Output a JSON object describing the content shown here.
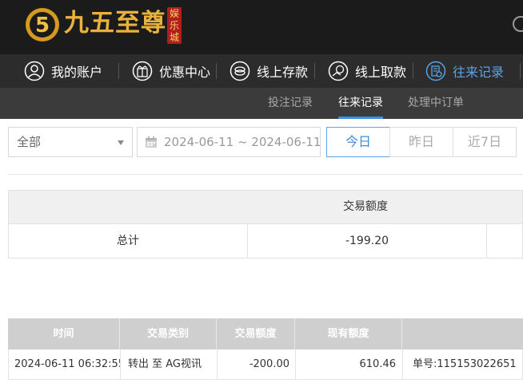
{
  "brand": {
    "name": "九五至尊",
    "badge": "娱乐城",
    "logo_icon": "five-coin-logo"
  },
  "nav": {
    "items": [
      {
        "label": "我的账户",
        "icon": "user-icon"
      },
      {
        "label": "优惠中心",
        "icon": "gift-icon"
      },
      {
        "label": "线上存款",
        "icon": "deposit-icon"
      },
      {
        "label": "线上取款",
        "icon": "withdraw-icon"
      },
      {
        "label": "往来记录",
        "icon": "records-icon",
        "active": true
      }
    ]
  },
  "subnav": {
    "items": [
      {
        "label": "投注记录"
      },
      {
        "label": "往来记录",
        "active": true
      },
      {
        "label": "处理中订单"
      }
    ]
  },
  "filters": {
    "type_selected": "全部",
    "date_range": "2024-06-11 ~ 2024-06-11",
    "quick": [
      {
        "label": "今日",
        "active": true
      },
      {
        "label": "昨日"
      },
      {
        "label": "近7日"
      }
    ]
  },
  "summary": {
    "header": "交易额度",
    "total_label": "总计",
    "total_value": "-199.20"
  },
  "records": {
    "columns": [
      "时间",
      "交易类别",
      "交易额度",
      "现有额度",
      ""
    ],
    "rows": [
      {
        "time": "2024-06-11 06:32:55",
        "type": "转出 至 AG视讯",
        "amount": "-200.00",
        "balance": "610.46",
        "note": "单号:115153022651"
      }
    ]
  },
  "colors": {
    "accent": "#3e8ede",
    "header_bg": "#1b1b1b",
    "nav_bg": "#2c2c2c",
    "subnav_bg": "#3b3b3b",
    "brand_gold": "#e9b23a"
  }
}
